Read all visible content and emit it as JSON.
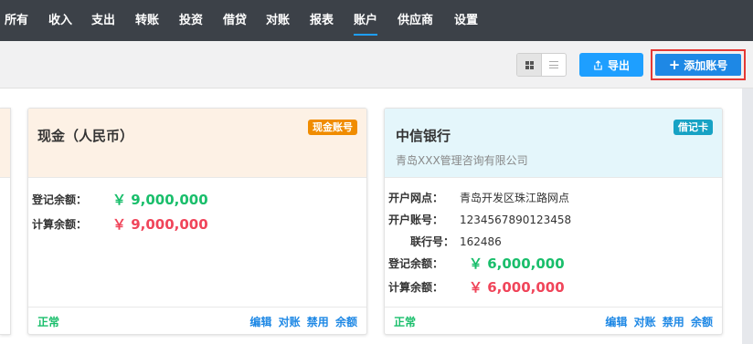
{
  "nav": {
    "items": [
      {
        "label": "所有"
      },
      {
        "label": "收入"
      },
      {
        "label": "支出"
      },
      {
        "label": "转账"
      },
      {
        "label": "投资"
      },
      {
        "label": "借贷"
      },
      {
        "label": "对账"
      },
      {
        "label": "报表"
      },
      {
        "label": "账户",
        "active": true
      },
      {
        "label": "供应商"
      },
      {
        "label": "设置"
      }
    ]
  },
  "toolbar": {
    "export_label": "导出",
    "add_label": "添加账号",
    "view_mode": "grid"
  },
  "cards": [
    {
      "title": "现金（人民币）",
      "badge": "现金账号",
      "badge_color": "#f08c00",
      "header_bg": "#fdf1e5",
      "rows": [
        {
          "label": "登记余额：",
          "value": "￥ 9,000,000",
          "tone": "green"
        },
        {
          "label": "计算余额：",
          "value": "￥ 9,000,000",
          "tone": "red"
        }
      ],
      "status": "正常",
      "actions": [
        "编辑",
        "对账",
        "禁用",
        "余额"
      ]
    },
    {
      "title": "中信银行",
      "subtitle": "青岛XXX管理咨询有限公司",
      "badge": "借记卡",
      "badge_color": "#17a2c4",
      "header_bg": "#e4f6fb",
      "rows": [
        {
          "label": "开户网点：",
          "value": "青岛开发区珠江路网点"
        },
        {
          "label": "开户账号：",
          "value": "1234567890123458"
        },
        {
          "label": "联行号：",
          "value": "162486"
        },
        {
          "label": "登记余额：",
          "value": "￥ 6,000,000",
          "tone": "green"
        },
        {
          "label": "计算余额：",
          "value": "￥ 6,000,000",
          "tone": "red"
        }
      ],
      "status": "正常",
      "actions": [
        "编辑",
        "对账",
        "禁用",
        "余额"
      ]
    }
  ]
}
